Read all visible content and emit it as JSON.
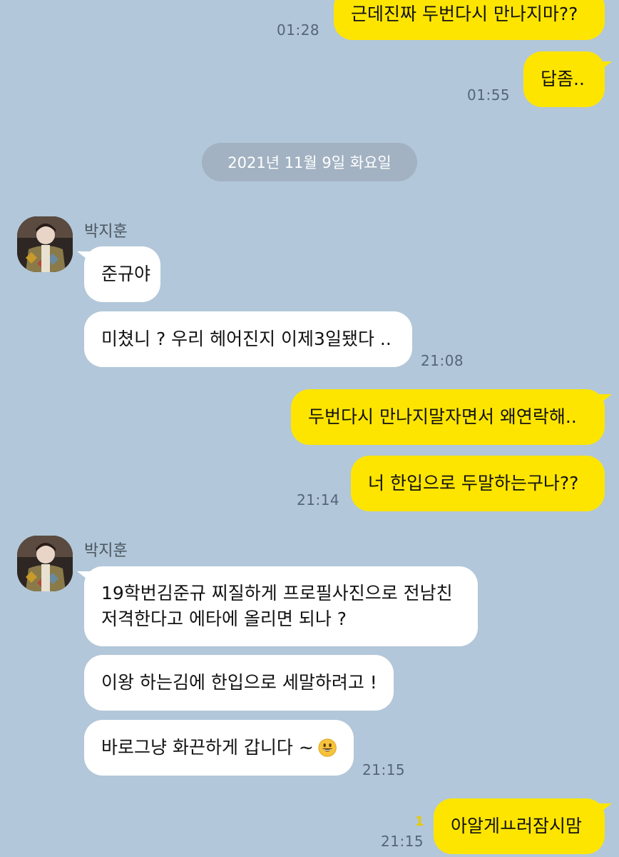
{
  "conversation": {
    "date_divider": "2021년 11월 9일 화요일",
    "sender_name_1": "박지훈",
    "sender_name_2": "박지훈",
    "messages": [
      {
        "from": "me",
        "text": "근데진짜 두번다시 만나지마??",
        "time": "01:28"
      },
      {
        "from": "me",
        "text": "답좀..",
        "time": "01:55"
      },
      {
        "from": "them",
        "text": "준규야"
      },
      {
        "from": "them",
        "text": "미쳤니 ? 우리 헤어진지 이제3일됐다 ..",
        "time": "21:08"
      },
      {
        "from": "me",
        "text": "두번다시 만나지말자면서 왜연락해.."
      },
      {
        "from": "me",
        "text": "너 한입으로 두말하는구나??",
        "time": "21:14"
      },
      {
        "from": "them",
        "text_line1": "19학번김준규 찌질하게 프로필사진으로 전남친",
        "text_line2": "저격한다고 에타에 올리면 되나 ?"
      },
      {
        "from": "them",
        "text": "이왕 하는김에 한입으로 세말하려고 !"
      },
      {
        "from": "them",
        "text": "바로그냥 화끈하게 갑니다 ~",
        "emoji": "smiling-face-emoji",
        "time": "21:15"
      },
      {
        "from": "me",
        "text": "아알게ㅛ러잠시맘",
        "time": "21:15",
        "unread": "1"
      }
    ]
  },
  "colors": {
    "background": "#b2c7d9",
    "my_bubble": "#fee500",
    "their_bubble": "#ffffff",
    "date_pill": "#a2b2c2"
  }
}
